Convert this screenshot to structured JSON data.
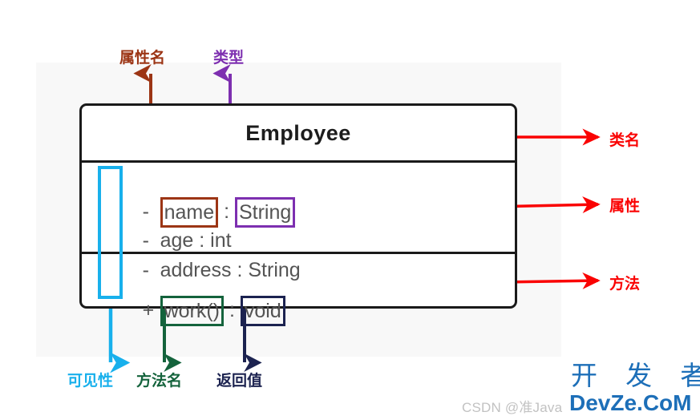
{
  "diagram": {
    "class_box": {
      "class_name": "Employee",
      "attributes": [
        {
          "visibility": "-",
          "name": "name",
          "sep": " : ",
          "type": "String"
        },
        {
          "visibility": "-",
          "name": "age",
          "sep": " : ",
          "type": "int"
        },
        {
          "visibility": "-",
          "name": "address",
          "sep": " : ",
          "type": "String"
        }
      ],
      "methods": [
        {
          "visibility": "+",
          "name": "work()",
          "sep": " : ",
          "type": "void"
        }
      ]
    },
    "annotations": {
      "top": [
        {
          "text": "属性名",
          "color": "#9c3515"
        },
        {
          "text": "类型",
          "color": "#7d2fb0"
        }
      ],
      "right": [
        {
          "text": "类名",
          "color": "#fa0202"
        },
        {
          "text": "属性",
          "color": "#fa0202"
        },
        {
          "text": "方法",
          "color": "#fa0202"
        }
      ],
      "bottom": [
        {
          "text": "可见性",
          "color": "#18b0ec"
        },
        {
          "text": "方法名",
          "color": "#14633c"
        },
        {
          "text": "返回值",
          "color": "#1c2350"
        }
      ]
    }
  },
  "watermarks": {
    "csdn": "CSDN @准Java",
    "devze_top": "开 发 者",
    "devze_bottom": "DevZe.CoM"
  }
}
